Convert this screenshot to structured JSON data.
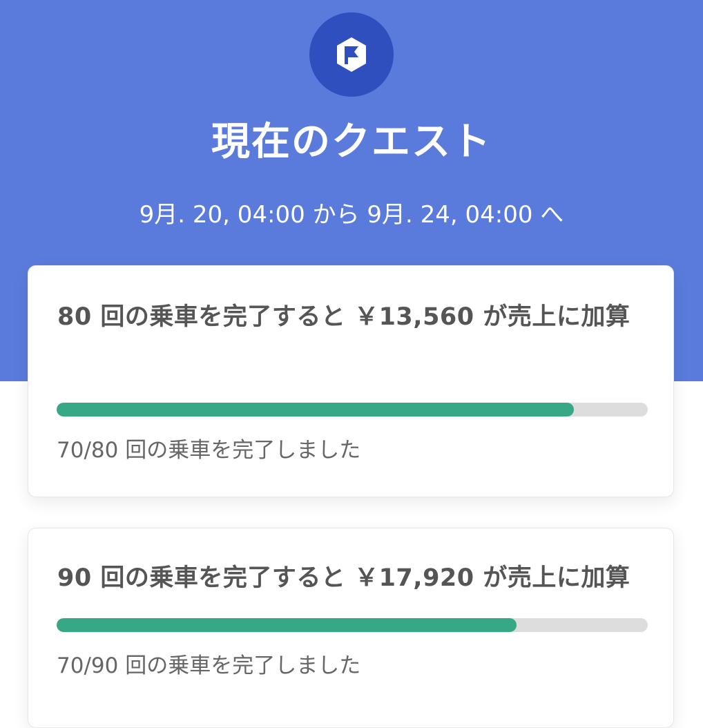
{
  "header": {
    "title": "現在のクエスト",
    "date_range": "9月. 20, 04:00 から 9月. 24, 04:00 へ",
    "icon": "flag-icon",
    "background_color": "#5a7bdb",
    "icon_background_color": "#2f4fbe"
  },
  "quests": [
    {
      "title": "80 回の乗車を完了すると ￥13,560 が売上に加算",
      "progress_text": "70/80 回の乗車を完了しました",
      "progress": 0.875,
      "progress_color": "#36a885"
    },
    {
      "title": "90 回の乗車を完了すると ￥17,920 が売上に加算",
      "progress_text": "70/90 回の乗車を完了しました",
      "progress": 0.7778,
      "progress_color": "#36a885"
    }
  ]
}
